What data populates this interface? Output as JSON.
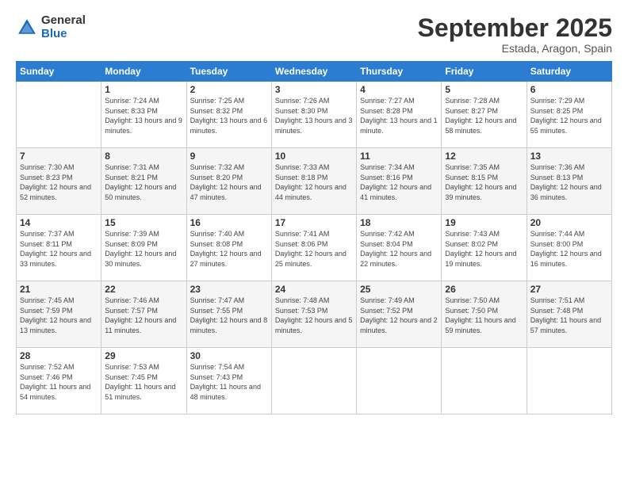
{
  "logo": {
    "general": "General",
    "blue": "Blue"
  },
  "title": "September 2025",
  "location": "Estada, Aragon, Spain",
  "days_of_week": [
    "Sunday",
    "Monday",
    "Tuesday",
    "Wednesday",
    "Thursday",
    "Friday",
    "Saturday"
  ],
  "weeks": [
    [
      {
        "day": "",
        "sunrise": "",
        "sunset": "",
        "daylight": ""
      },
      {
        "day": "1",
        "sunrise": "Sunrise: 7:24 AM",
        "sunset": "Sunset: 8:33 PM",
        "daylight": "Daylight: 13 hours and 9 minutes."
      },
      {
        "day": "2",
        "sunrise": "Sunrise: 7:25 AM",
        "sunset": "Sunset: 8:32 PM",
        "daylight": "Daylight: 13 hours and 6 minutes."
      },
      {
        "day": "3",
        "sunrise": "Sunrise: 7:26 AM",
        "sunset": "Sunset: 8:30 PM",
        "daylight": "Daylight: 13 hours and 3 minutes."
      },
      {
        "day": "4",
        "sunrise": "Sunrise: 7:27 AM",
        "sunset": "Sunset: 8:28 PM",
        "daylight": "Daylight: 13 hours and 1 minute."
      },
      {
        "day": "5",
        "sunrise": "Sunrise: 7:28 AM",
        "sunset": "Sunset: 8:27 PM",
        "daylight": "Daylight: 12 hours and 58 minutes."
      },
      {
        "day": "6",
        "sunrise": "Sunrise: 7:29 AM",
        "sunset": "Sunset: 8:25 PM",
        "daylight": "Daylight: 12 hours and 55 minutes."
      }
    ],
    [
      {
        "day": "7",
        "sunrise": "Sunrise: 7:30 AM",
        "sunset": "Sunset: 8:23 PM",
        "daylight": "Daylight: 12 hours and 52 minutes."
      },
      {
        "day": "8",
        "sunrise": "Sunrise: 7:31 AM",
        "sunset": "Sunset: 8:21 PM",
        "daylight": "Daylight: 12 hours and 50 minutes."
      },
      {
        "day": "9",
        "sunrise": "Sunrise: 7:32 AM",
        "sunset": "Sunset: 8:20 PM",
        "daylight": "Daylight: 12 hours and 47 minutes."
      },
      {
        "day": "10",
        "sunrise": "Sunrise: 7:33 AM",
        "sunset": "Sunset: 8:18 PM",
        "daylight": "Daylight: 12 hours and 44 minutes."
      },
      {
        "day": "11",
        "sunrise": "Sunrise: 7:34 AM",
        "sunset": "Sunset: 8:16 PM",
        "daylight": "Daylight: 12 hours and 41 minutes."
      },
      {
        "day": "12",
        "sunrise": "Sunrise: 7:35 AM",
        "sunset": "Sunset: 8:15 PM",
        "daylight": "Daylight: 12 hours and 39 minutes."
      },
      {
        "day": "13",
        "sunrise": "Sunrise: 7:36 AM",
        "sunset": "Sunset: 8:13 PM",
        "daylight": "Daylight: 12 hours and 36 minutes."
      }
    ],
    [
      {
        "day": "14",
        "sunrise": "Sunrise: 7:37 AM",
        "sunset": "Sunset: 8:11 PM",
        "daylight": "Daylight: 12 hours and 33 minutes."
      },
      {
        "day": "15",
        "sunrise": "Sunrise: 7:39 AM",
        "sunset": "Sunset: 8:09 PM",
        "daylight": "Daylight: 12 hours and 30 minutes."
      },
      {
        "day": "16",
        "sunrise": "Sunrise: 7:40 AM",
        "sunset": "Sunset: 8:08 PM",
        "daylight": "Daylight: 12 hours and 27 minutes."
      },
      {
        "day": "17",
        "sunrise": "Sunrise: 7:41 AM",
        "sunset": "Sunset: 8:06 PM",
        "daylight": "Daylight: 12 hours and 25 minutes."
      },
      {
        "day": "18",
        "sunrise": "Sunrise: 7:42 AM",
        "sunset": "Sunset: 8:04 PM",
        "daylight": "Daylight: 12 hours and 22 minutes."
      },
      {
        "day": "19",
        "sunrise": "Sunrise: 7:43 AM",
        "sunset": "Sunset: 8:02 PM",
        "daylight": "Daylight: 12 hours and 19 minutes."
      },
      {
        "day": "20",
        "sunrise": "Sunrise: 7:44 AM",
        "sunset": "Sunset: 8:00 PM",
        "daylight": "Daylight: 12 hours and 16 minutes."
      }
    ],
    [
      {
        "day": "21",
        "sunrise": "Sunrise: 7:45 AM",
        "sunset": "Sunset: 7:59 PM",
        "daylight": "Daylight: 12 hours and 13 minutes."
      },
      {
        "day": "22",
        "sunrise": "Sunrise: 7:46 AM",
        "sunset": "Sunset: 7:57 PM",
        "daylight": "Daylight: 12 hours and 11 minutes."
      },
      {
        "day": "23",
        "sunrise": "Sunrise: 7:47 AM",
        "sunset": "Sunset: 7:55 PM",
        "daylight": "Daylight: 12 hours and 8 minutes."
      },
      {
        "day": "24",
        "sunrise": "Sunrise: 7:48 AM",
        "sunset": "Sunset: 7:53 PM",
        "daylight": "Daylight: 12 hours and 5 minutes."
      },
      {
        "day": "25",
        "sunrise": "Sunrise: 7:49 AM",
        "sunset": "Sunset: 7:52 PM",
        "daylight": "Daylight: 12 hours and 2 minutes."
      },
      {
        "day": "26",
        "sunrise": "Sunrise: 7:50 AM",
        "sunset": "Sunset: 7:50 PM",
        "daylight": "Daylight: 11 hours and 59 minutes."
      },
      {
        "day": "27",
        "sunrise": "Sunrise: 7:51 AM",
        "sunset": "Sunset: 7:48 PM",
        "daylight": "Daylight: 11 hours and 57 minutes."
      }
    ],
    [
      {
        "day": "28",
        "sunrise": "Sunrise: 7:52 AM",
        "sunset": "Sunset: 7:46 PM",
        "daylight": "Daylight: 11 hours and 54 minutes."
      },
      {
        "day": "29",
        "sunrise": "Sunrise: 7:53 AM",
        "sunset": "Sunset: 7:45 PM",
        "daylight": "Daylight: 11 hours and 51 minutes."
      },
      {
        "day": "30",
        "sunrise": "Sunrise: 7:54 AM",
        "sunset": "Sunset: 7:43 PM",
        "daylight": "Daylight: 11 hours and 48 minutes."
      },
      {
        "day": "",
        "sunrise": "",
        "sunset": "",
        "daylight": ""
      },
      {
        "day": "",
        "sunrise": "",
        "sunset": "",
        "daylight": ""
      },
      {
        "day": "",
        "sunrise": "",
        "sunset": "",
        "daylight": ""
      },
      {
        "day": "",
        "sunrise": "",
        "sunset": "",
        "daylight": ""
      }
    ]
  ]
}
